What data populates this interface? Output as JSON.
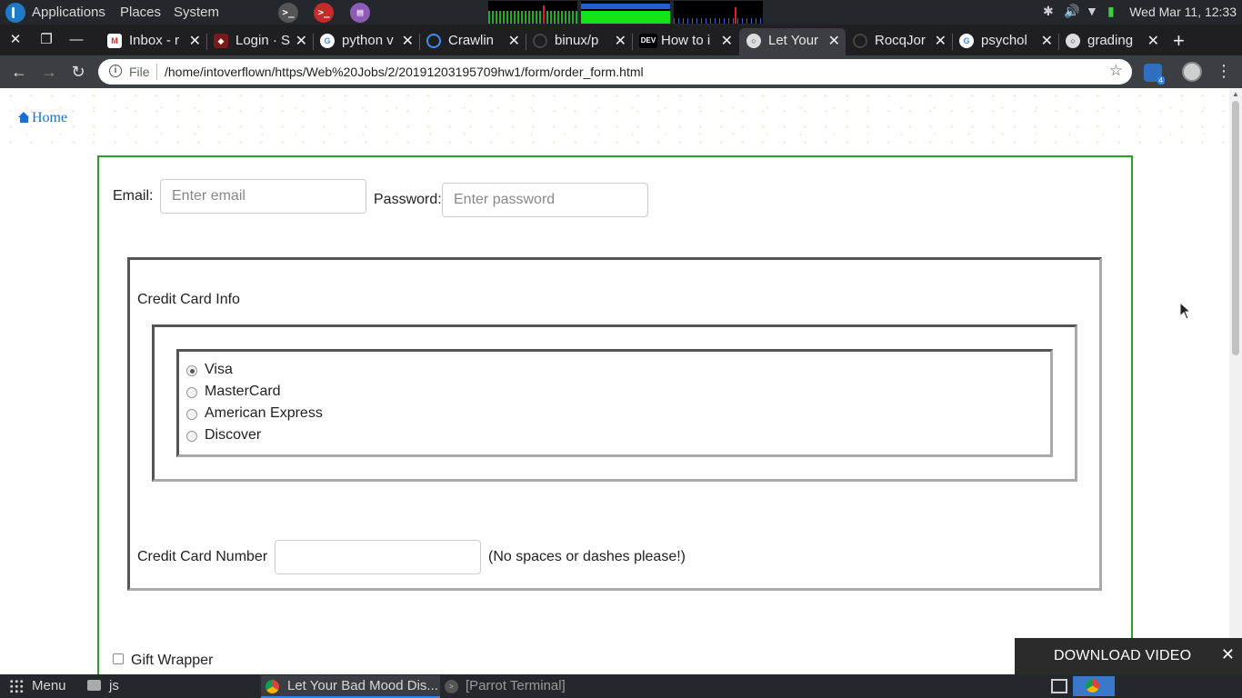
{
  "system_panel": {
    "menus": [
      "Applications",
      "Places",
      "System"
    ],
    "clock": "Wed Mar 11, 12:33",
    "tray_icons": [
      "bluetooth-icon",
      "volume-icon",
      "wifi-icon",
      "battery-icon"
    ],
    "launchers": [
      "terminal-icon",
      "root-terminal-icon",
      "text-editor-icon"
    ]
  },
  "browser": {
    "tabs": [
      {
        "title": "Inbox - r",
        "icon": "gmail-icon"
      },
      {
        "title": "Login · S",
        "icon": "site-icon"
      },
      {
        "title": "python v",
        "icon": "google-icon"
      },
      {
        "title": "Crawlin",
        "icon": "site-icon"
      },
      {
        "title": "binux/p",
        "icon": "github-icon"
      },
      {
        "title": "How to i",
        "icon": "dev-icon"
      },
      {
        "title": "Let Your",
        "icon": "globe-icon",
        "active": true
      },
      {
        "title": "RocqJor",
        "icon": "github-icon"
      },
      {
        "title": "psychol",
        "icon": "google-icon"
      },
      {
        "title": "grading",
        "icon": "globe-icon"
      }
    ],
    "dev_badge": "DEV",
    "extension_badge": "4",
    "address": {
      "scheme": "File",
      "url": "/home/intoverflown/https/Web%20Jobs/2/20191203195709hw1/form/order_form.html"
    }
  },
  "page": {
    "home_link": "Home",
    "email_label": "Email:",
    "email_placeholder": "Enter email",
    "password_label": "Password:",
    "password_placeholder": "Enter password",
    "cc_heading": "Credit Card Info",
    "card_types": [
      {
        "label": "Visa",
        "checked": true
      },
      {
        "label": "MasterCard",
        "checked": false
      },
      {
        "label": "American Express",
        "checked": false
      },
      {
        "label": "Discover",
        "checked": false
      }
    ],
    "cc_number_label": "Credit Card Number",
    "cc_number_value": "",
    "cc_number_hint": "(No spaces or dashes please!)",
    "gift_wrapper_label": "Gift Wrapper",
    "download_video": "DOWNLOAD VIDEO"
  },
  "taskbar": {
    "menu_label": "Menu",
    "folder_label": "js",
    "windows": [
      {
        "title": "Let Your Bad Mood Dis...",
        "active": true
      },
      {
        "title": "[Parrot Terminal]",
        "active": false
      }
    ]
  },
  "colors": {
    "form_border": "#28a02a",
    "link": "#1f6fd1",
    "panel_bg": "#24272b",
    "toolbar_bg": "#3b3e42"
  }
}
